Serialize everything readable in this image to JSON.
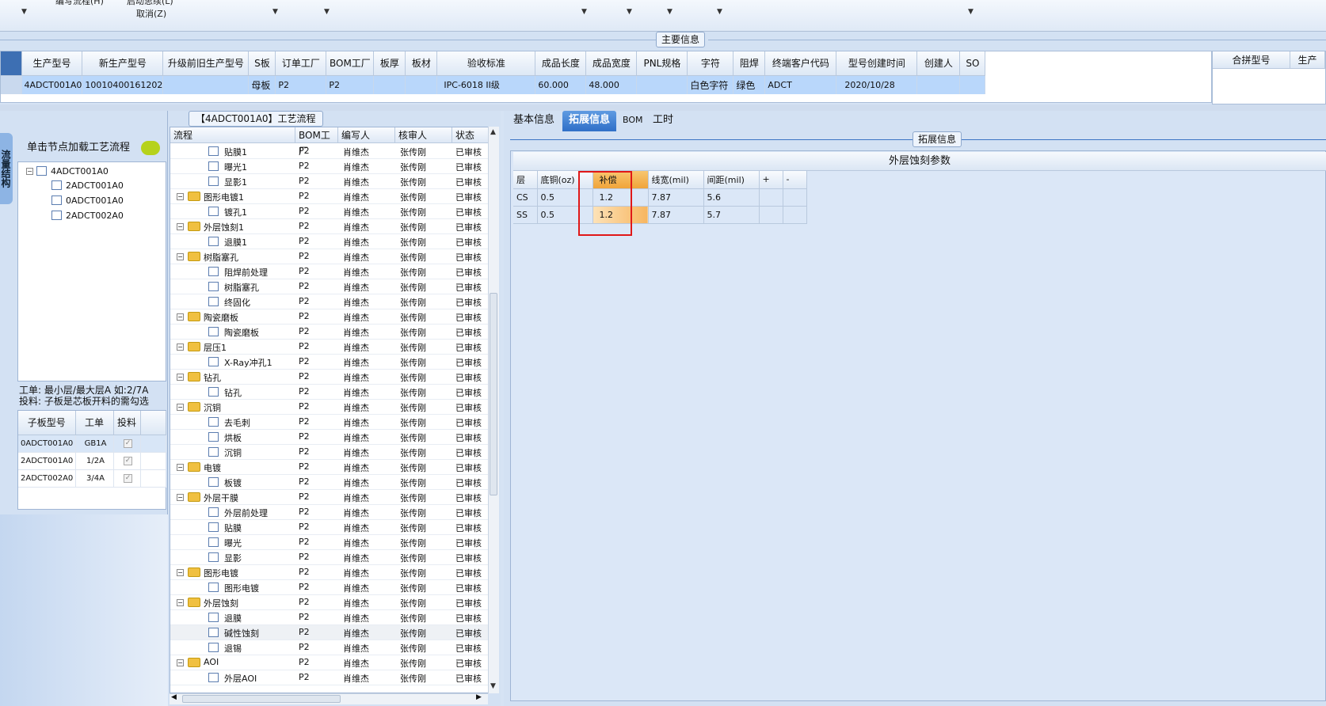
{
  "top": {
    "menu_edit": "编写流程(H)",
    "menu_start": "启动思续(L)",
    "menu_cancel": "取消(Z)"
  },
  "main_info": {
    "legend": "主要信息",
    "columns": [
      "生产型号",
      "新生产型号",
      "升级前旧生产型号",
      "S板",
      "订单工厂",
      "BOM工厂",
      "板厚",
      "板材",
      "验收标准",
      "成品长度",
      "成品宽度",
      "PNL规格",
      "字符",
      "阻焊",
      "终端客户代码",
      "型号创建时间",
      "创建人",
      "SO"
    ],
    "row": [
      "4ADCT001A0",
      "10010400161202",
      "",
      "母板",
      "P2",
      "P2",
      "",
      "",
      "IPC-6018 II级",
      "60.000",
      "48.000",
      "",
      "白色字符",
      "绿色",
      "ADCT",
      "2020/10/28",
      "",
      ""
    ]
  },
  "merge": {
    "col1": "合拼型号",
    "col2": "生产"
  },
  "left": {
    "side_tab": "流量结构",
    "node_header": "单击节点加载工艺流程",
    "tree": [
      {
        "label": "4ADCT001A0"
      },
      {
        "label": "2ADCT001A0"
      },
      {
        "label": "0ADCT001A0"
      },
      {
        "label": "2ADCT002A0"
      }
    ],
    "note1": "工单: 最小层/最大层A 如:2/7A",
    "note2": "投料: 子板是芯板开料的需勾选",
    "sub_columns": [
      "子板型号",
      "工单",
      "投料"
    ],
    "sub_rows": [
      [
        "0ADCT001A0",
        "GB1A",
        "✓"
      ],
      [
        "2ADCT001A0",
        "1/2A",
        "✓"
      ],
      [
        "2ADCT002A0",
        "3/4A",
        "✓"
      ]
    ]
  },
  "process": {
    "title": "【4ADCT001A0】工艺流程",
    "columns": [
      "流程",
      "BOM工厂",
      "编写人",
      "核审人",
      "状态"
    ],
    "rows": [
      {
        "name": "贴膜1",
        "folder": false,
        "bom": "P2",
        "writer": "肖维杰",
        "reviewer": "张传刚",
        "status": "已审核"
      },
      {
        "name": "曝光1",
        "folder": false,
        "bom": "P2",
        "writer": "肖维杰",
        "reviewer": "张传刚",
        "status": "已审核"
      },
      {
        "name": "显影1",
        "folder": false,
        "bom": "P2",
        "writer": "肖维杰",
        "reviewer": "张传刚",
        "status": "已审核"
      },
      {
        "name": "图形电镀1",
        "folder": true,
        "bom": "P2",
        "writer": "肖维杰",
        "reviewer": "张传刚",
        "status": "已审核"
      },
      {
        "name": "镀孔1",
        "folder": false,
        "bom": "P2",
        "writer": "肖维杰",
        "reviewer": "张传刚",
        "status": "已审核"
      },
      {
        "name": "外层蚀刻1",
        "folder": true,
        "bom": "P2",
        "writer": "肖维杰",
        "reviewer": "张传刚",
        "status": "已审核"
      },
      {
        "name": "退膜1",
        "folder": false,
        "bom": "P2",
        "writer": "肖维杰",
        "reviewer": "张传刚",
        "status": "已审核"
      },
      {
        "name": "树脂塞孔",
        "folder": true,
        "bom": "P2",
        "writer": "肖维杰",
        "reviewer": "张传刚",
        "status": "已审核"
      },
      {
        "name": "阻焊前处理",
        "folder": false,
        "bom": "P2",
        "writer": "肖维杰",
        "reviewer": "张传刚",
        "status": "已审核"
      },
      {
        "name": "树脂塞孔",
        "folder": false,
        "bom": "P2",
        "writer": "肖维杰",
        "reviewer": "张传刚",
        "status": "已审核"
      },
      {
        "name": "终固化",
        "folder": false,
        "bom": "P2",
        "writer": "肖维杰",
        "reviewer": "张传刚",
        "status": "已审核"
      },
      {
        "name": "陶瓷磨板",
        "folder": true,
        "bom": "P2",
        "writer": "肖维杰",
        "reviewer": "张传刚",
        "status": "已审核"
      },
      {
        "name": "陶瓷磨板",
        "folder": false,
        "bom": "P2",
        "writer": "肖维杰",
        "reviewer": "张传刚",
        "status": "已审核"
      },
      {
        "name": "层压1",
        "folder": true,
        "bom": "P2",
        "writer": "肖维杰",
        "reviewer": "张传刚",
        "status": "已审核"
      },
      {
        "name": "X-Ray冲孔1",
        "folder": false,
        "bom": "P2",
        "writer": "肖维杰",
        "reviewer": "张传刚",
        "status": "已审核"
      },
      {
        "name": "钻孔",
        "folder": true,
        "bom": "P2",
        "writer": "肖维杰",
        "reviewer": "张传刚",
        "status": "已审核"
      },
      {
        "name": "钻孔",
        "folder": false,
        "bom": "P2",
        "writer": "肖维杰",
        "reviewer": "张传刚",
        "status": "已审核"
      },
      {
        "name": "沉铜",
        "folder": true,
        "bom": "P2",
        "writer": "肖维杰",
        "reviewer": "张传刚",
        "status": "已审核"
      },
      {
        "name": "去毛刺",
        "folder": false,
        "bom": "P2",
        "writer": "肖维杰",
        "reviewer": "张传刚",
        "status": "已审核"
      },
      {
        "name": "烘板",
        "folder": false,
        "bom": "P2",
        "writer": "肖维杰",
        "reviewer": "张传刚",
        "status": "已审核"
      },
      {
        "name": "沉铜",
        "folder": false,
        "bom": "P2",
        "writer": "肖维杰",
        "reviewer": "张传刚",
        "status": "已审核"
      },
      {
        "name": "电镀",
        "folder": true,
        "bom": "P2",
        "writer": "肖维杰",
        "reviewer": "张传刚",
        "status": "已审核"
      },
      {
        "name": "板镀",
        "folder": false,
        "bom": "P2",
        "writer": "肖维杰",
        "reviewer": "张传刚",
        "status": "已审核"
      },
      {
        "name": "外层干膜",
        "folder": true,
        "bom": "P2",
        "writer": "肖维杰",
        "reviewer": "张传刚",
        "status": "已审核"
      },
      {
        "name": "外层前处理",
        "folder": false,
        "bom": "P2",
        "writer": "肖维杰",
        "reviewer": "张传刚",
        "status": "已审核"
      },
      {
        "name": "贴膜",
        "folder": false,
        "bom": "P2",
        "writer": "肖维杰",
        "reviewer": "张传刚",
        "status": "已审核"
      },
      {
        "name": "曝光",
        "folder": false,
        "bom": "P2",
        "writer": "肖维杰",
        "reviewer": "张传刚",
        "status": "已审核"
      },
      {
        "name": "显影",
        "folder": false,
        "bom": "P2",
        "writer": "肖维杰",
        "reviewer": "张传刚",
        "status": "已审核"
      },
      {
        "name": "图形电镀",
        "folder": true,
        "bom": "P2",
        "writer": "肖维杰",
        "reviewer": "张传刚",
        "status": "已审核"
      },
      {
        "name": "图形电镀",
        "folder": false,
        "bom": "P2",
        "writer": "肖维杰",
        "reviewer": "张传刚",
        "status": "已审核"
      },
      {
        "name": "外层蚀刻",
        "folder": true,
        "bom": "P2",
        "writer": "肖维杰",
        "reviewer": "张传刚",
        "status": "已审核"
      },
      {
        "name": "退膜",
        "folder": false,
        "bom": "P2",
        "writer": "肖维杰",
        "reviewer": "张传刚",
        "status": "已审核"
      },
      {
        "name": "碱性蚀刻",
        "folder": false,
        "bom": "P2",
        "writer": "肖维杰",
        "reviewer": "张传刚",
        "status": "已审核"
      },
      {
        "name": "退锡",
        "folder": false,
        "bom": "P2",
        "writer": "肖维杰",
        "reviewer": "张传刚",
        "status": "已审核"
      },
      {
        "name": "AOI",
        "folder": true,
        "bom": "P2",
        "writer": "肖维杰",
        "reviewer": "张传刚",
        "status": "已审核"
      },
      {
        "name": "外层AOI",
        "folder": false,
        "bom": "P2",
        "writer": "肖维杰",
        "reviewer": "张传刚",
        "status": "已审核"
      }
    ]
  },
  "right": {
    "tabs": [
      "基本信息",
      "拓展信息",
      "BOM",
      "工时"
    ],
    "active_tab": 1,
    "ext_legend": "拓展信息",
    "panel_title": "外层蚀刻参数",
    "columns": [
      "层",
      "底铜(oz)",
      "补偿",
      "线宽(mil)",
      "间距(mil)",
      "+",
      "-"
    ],
    "rows": [
      [
        "CS",
        "0.5",
        "1.2",
        "7.87",
        "5.6",
        "",
        ""
      ],
      [
        "SS",
        "0.5",
        "1.2",
        "7.87",
        "5.7",
        "",
        ""
      ]
    ]
  }
}
